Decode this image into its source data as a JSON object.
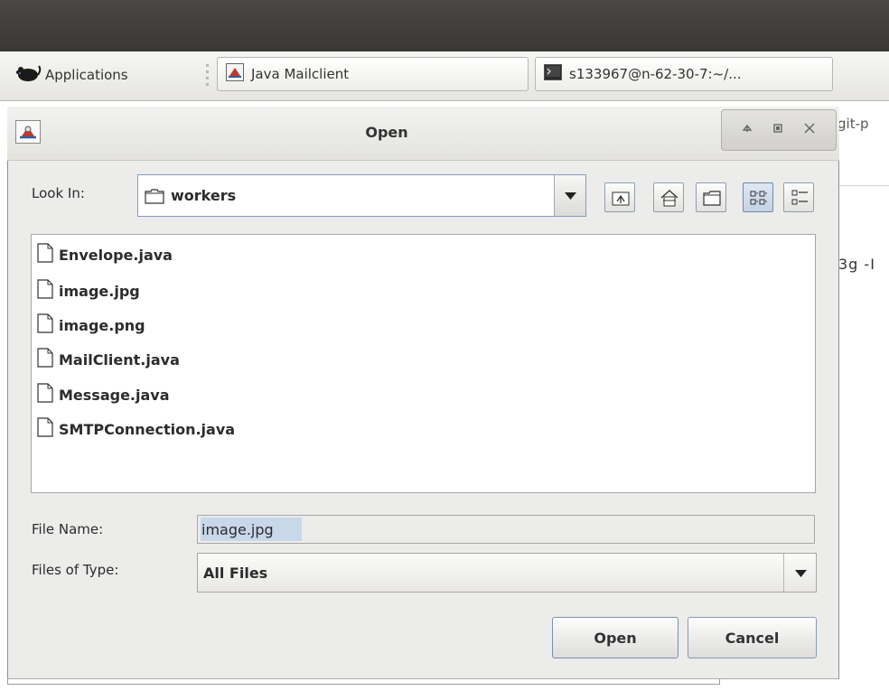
{
  "taskbar": {
    "applications_label": "Applications",
    "tasks": [
      {
        "label": "Java Mailclient"
      },
      {
        "label": "s133967@n-62-30-7:~/..."
      }
    ]
  },
  "background_app": {
    "fragment_top": "git-p",
    "fragment_mid": "3g -I"
  },
  "dialog": {
    "title": "Open",
    "look_in_label": "Look In:",
    "look_in_value": "workers",
    "files": [
      "Envelope.java",
      "image.jpg",
      "image.png",
      "MailClient.java",
      "Message.java",
      "SMTPConnection.java"
    ],
    "file_name_label": "File Name:",
    "file_name_value": "image.jpg",
    "files_of_type_label": "Files of Type:",
    "files_of_type_value": "All Files",
    "open_label": "Open",
    "cancel_label": "Cancel"
  },
  "icons": {
    "applications": "xfce-mouse-icon",
    "window_controls": [
      "chevron-up-icon",
      "maximize-icon",
      "close-icon"
    ]
  }
}
